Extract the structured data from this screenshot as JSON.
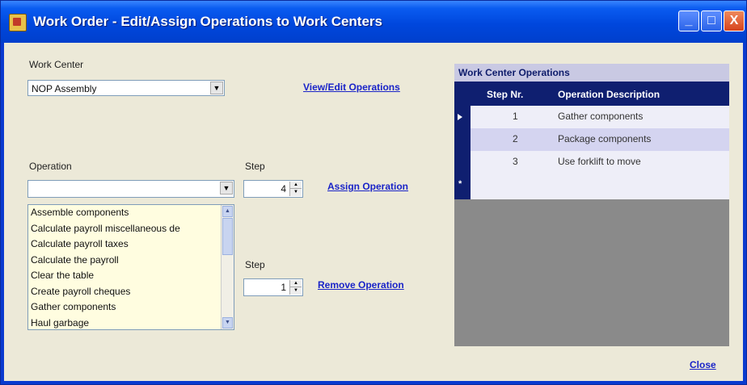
{
  "window": {
    "title": "Work Order - Edit/Assign Operations to Work Centers",
    "minimize": "_",
    "maximize": "□",
    "close": "X"
  },
  "work_center": {
    "label": "Work Center",
    "selected": "NOP Assembly"
  },
  "links": {
    "view_edit": "View/Edit Operations",
    "assign": "Assign Operation",
    "remove": "Remove Operation",
    "close": "Close"
  },
  "operation": {
    "label": "Operation",
    "selected": "",
    "options": [
      "Assemble components",
      "Calculate payroll miscellaneous de",
      "Calculate payroll taxes",
      "Calculate the payroll",
      "Clear the table",
      "Create payroll cheques",
      "Gather components",
      "Haul garbage"
    ]
  },
  "assign_step": {
    "label": "Step",
    "value": "4"
  },
  "remove_step": {
    "label": "Step",
    "value": "1"
  },
  "grid": {
    "caption": "Work Center Operations",
    "headers": [
      "Step Nr.",
      "Operation Description"
    ],
    "rows": [
      {
        "step": "1",
        "description": "Gather components"
      },
      {
        "step": "2",
        "description": "Package components"
      },
      {
        "step": "3",
        "description": "Use forklift to move"
      }
    ],
    "new_row_marker": "*"
  },
  "colors": {
    "titlebar": "#0047dd",
    "client": "#ece9d8",
    "grid_header": "#0f1f70",
    "link": "#1a24c8"
  }
}
